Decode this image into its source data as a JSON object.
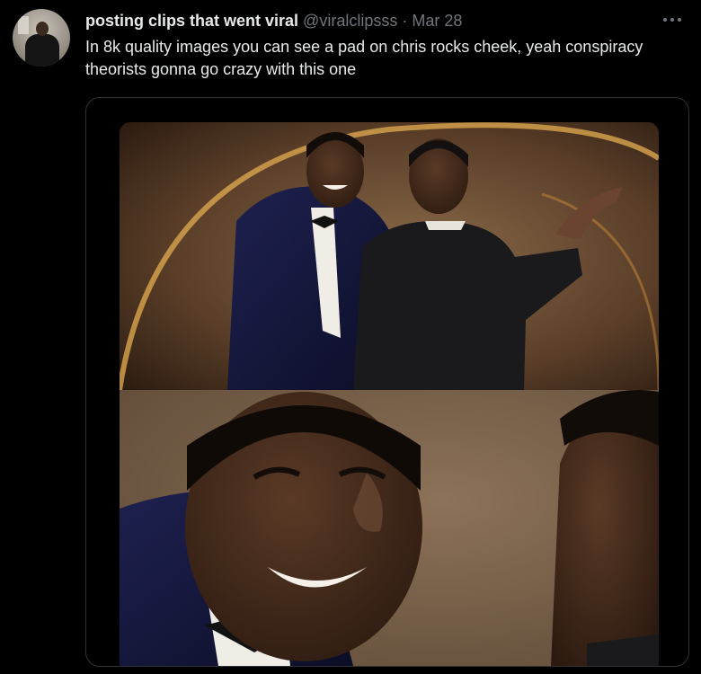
{
  "tweet": {
    "author": {
      "display_name": "posting clips that went viral",
      "handle": "@viralclipsss",
      "separator": "·",
      "date": "Mar 28"
    },
    "text": "In 8k quality images you can see a pad on chris rocks cheek, yeah conspiracy theorists gonna go crazy with this one",
    "more_icon": "more-horizontal-icon",
    "media": {
      "kind": "photo-collage",
      "panels": 2
    }
  },
  "colors": {
    "background": "#000000",
    "text_primary": "#e7e9ea",
    "text_secondary": "#71767b",
    "card_border": "#2f3336"
  }
}
